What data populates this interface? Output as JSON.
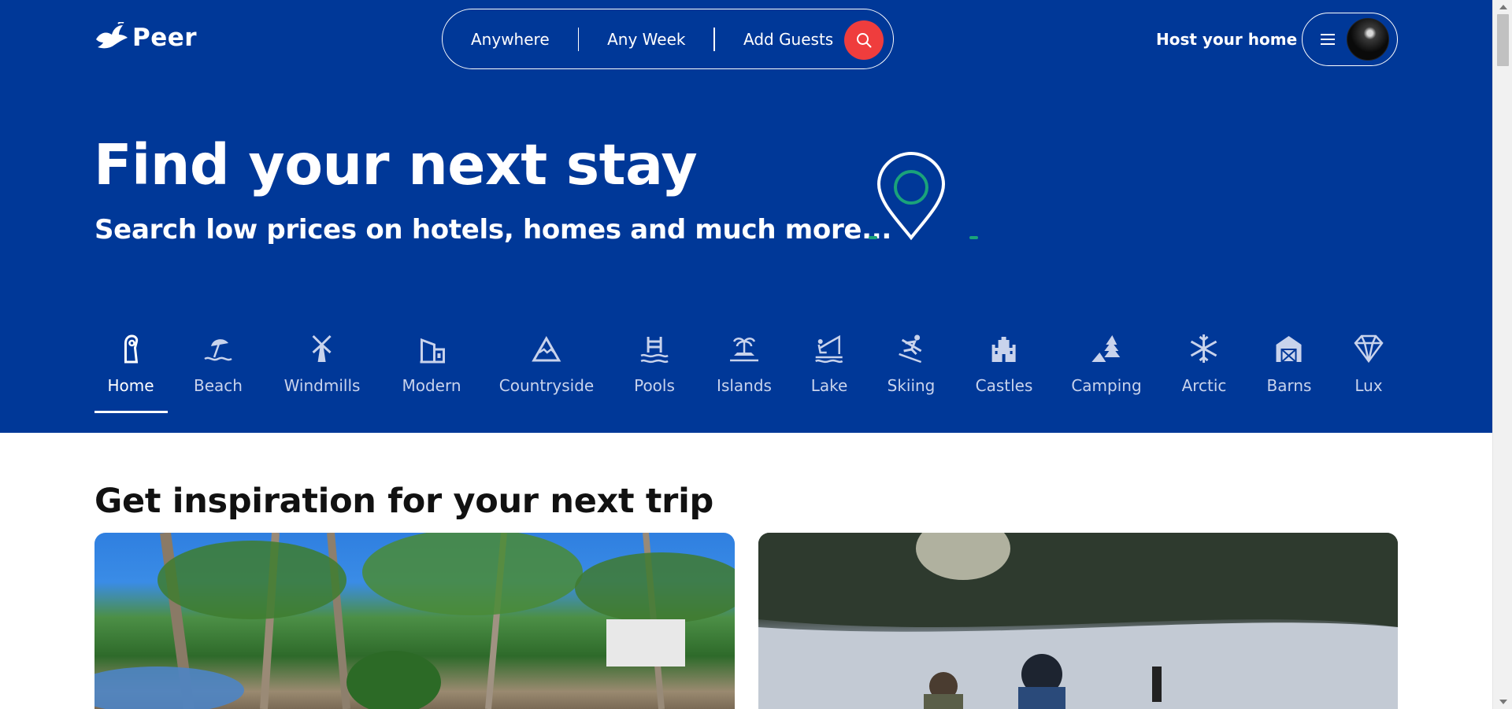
{
  "header": {
    "logo_text": "Peer",
    "logo_icon": "dove-icon",
    "search": {
      "where": "Anywhere",
      "when": "Any Week",
      "who": "Add Guests",
      "button_icon": "search-icon"
    },
    "host_link": "Host your home",
    "menu_icon": "hamburger-icon"
  },
  "hero": {
    "title": "Find your next stay",
    "subtitle": "Search low prices on hotels, homes and much more..."
  },
  "categories": [
    {
      "label": "Home",
      "icon": "door-hanger-icon",
      "active": true
    },
    {
      "label": "Beach",
      "icon": "beach-umbrella-icon",
      "active": false
    },
    {
      "label": "Windmills",
      "icon": "windmill-icon",
      "active": false
    },
    {
      "label": "Modern",
      "icon": "modern-house-icon",
      "active": false
    },
    {
      "label": "Countryside",
      "icon": "mountain-icon",
      "active": false
    },
    {
      "label": "Pools",
      "icon": "pool-icon",
      "active": false
    },
    {
      "label": "Islands",
      "icon": "island-icon",
      "active": false
    },
    {
      "label": "Lake",
      "icon": "fishing-icon",
      "active": false
    },
    {
      "label": "Skiing",
      "icon": "skier-icon",
      "active": false
    },
    {
      "label": "Castles",
      "icon": "castle-icon",
      "active": false
    },
    {
      "label": "Camping",
      "icon": "tent-icon",
      "active": false
    },
    {
      "label": "Arctic",
      "icon": "snowflake-icon",
      "active": false
    },
    {
      "label": "Barns",
      "icon": "barn-icon",
      "active": false
    },
    {
      "label": "Lux",
      "icon": "diamond-icon",
      "active": false
    }
  ],
  "inspiration": {
    "title": "Get inspiration for your next trip"
  },
  "colors": {
    "brand_blue": "#003898",
    "search_red": "#ef3d3d",
    "pin_green": "#1aa37a"
  }
}
